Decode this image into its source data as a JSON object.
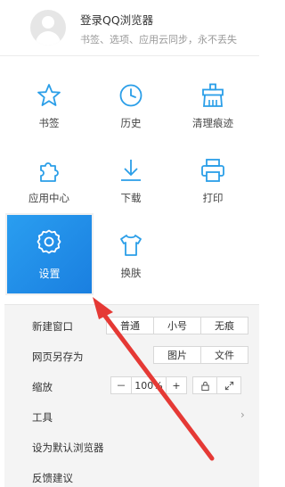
{
  "header": {
    "login_title": "登录QQ浏览器",
    "login_subtitle": "书签、选项、应用云同步，永不丢失"
  },
  "grid": {
    "bookmarks": "书签",
    "history": "历史",
    "clear_traces": "清理痕迹",
    "app_center": "应用中心",
    "downloads": "下载",
    "print": "打印",
    "settings": "设置",
    "skin": "换肤"
  },
  "menu": {
    "new_window": "新建窗口",
    "mode_normal": "普通",
    "mode_small": "小号",
    "mode_incognito": "无痕",
    "save_page_as": "网页另存为",
    "save_image": "图片",
    "save_file": "文件",
    "zoom": "缩放",
    "zoom_minus": "－",
    "zoom_value": "100%",
    "zoom_plus": "+",
    "tools": "工具",
    "set_default": "设为默认浏览器",
    "feedback": "反馈建议"
  },
  "colors": {
    "accent": "#1a8fe8",
    "icon": "#2a9ee8",
    "arrow": "#e53935"
  }
}
